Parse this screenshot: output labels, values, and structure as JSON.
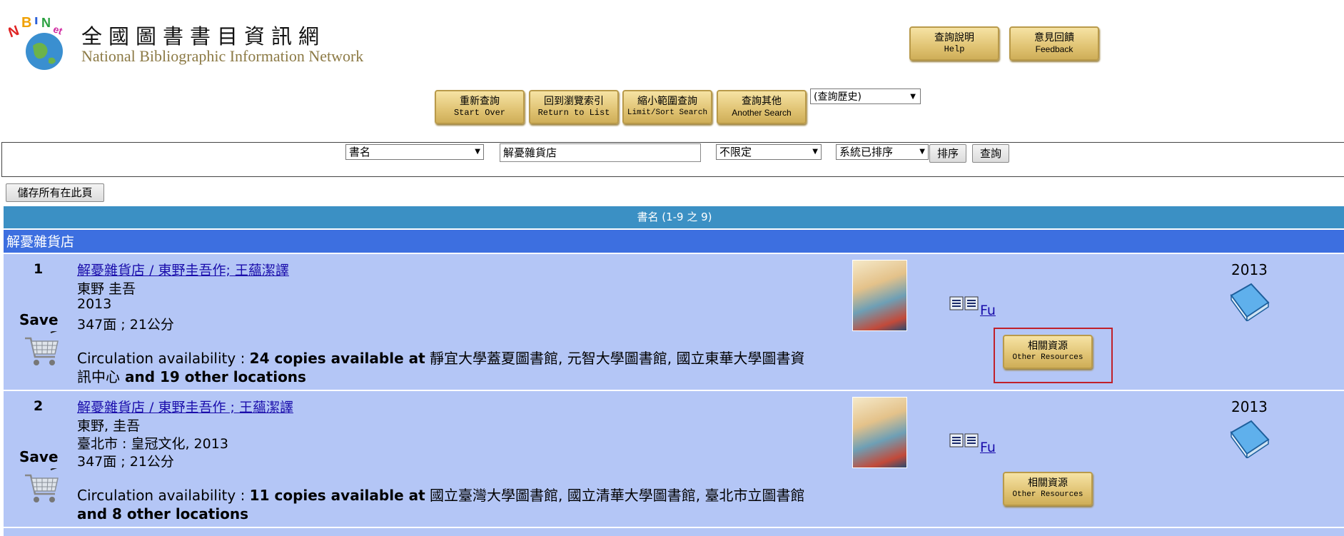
{
  "header": {
    "title_zh": "全國圖書書目資訊網",
    "title_en": "National Bibliographic Information Network",
    "logo_alt": "NBINet",
    "help": {
      "zh": "查詢說明",
      "en": "Help"
    },
    "feedback": {
      "zh": "意見回饋",
      "en": "Feedback"
    }
  },
  "toolbar": {
    "start_over": {
      "zh": "重新查詢",
      "en": "Start Over"
    },
    "return_list": {
      "zh": "回到瀏覽索引",
      "en": "Return to List"
    },
    "limit_sort": {
      "zh": "縮小範圍查詢",
      "en": "Limit/Sort Search"
    },
    "another": {
      "zh": "查詢其他",
      "en": "Another Search"
    },
    "history": "(查詢歷史)"
  },
  "search": {
    "field": "書名",
    "query": "解憂雜貨店",
    "limit": "不限定",
    "sort": "系統已排序",
    "sort_button": "排序",
    "search_button": "查詢"
  },
  "save_all_button": "儲存所有在此頁",
  "results_header": "書名 (1-9 之 9)",
  "group_heading": "解憂雜貨店",
  "records": [
    {
      "num": "1",
      "save": "Save",
      "title": "解憂雜貨店 / 東野圭吾作; 王蘊潔譯",
      "author": "東野 圭吾",
      "pub": "2013",
      "extent": "347面 ; 21公分",
      "circ_label": "Circulation availability : ",
      "circ_bold": "24 copies available at",
      "circ_libs": " 靜宜大學蓋夏圖書館, 元智大學圖書館, 國立東華大學圖書資訊中心",
      "circ_tail": " and 19 other locations",
      "fu": "Fu",
      "year": "2013",
      "other_res": {
        "zh": "相關資源",
        "en": "Other Resources"
      }
    },
    {
      "num": "2",
      "save": "Save",
      "title": "解憂雜貨店 / 東野圭吾作 ; 王蘊潔譯",
      "author": "東野, 圭吾",
      "pub": "臺北市 : 皇冠文化, 2013",
      "extent": "347面 ; 21公分",
      "circ_label": "Circulation availability : ",
      "circ_bold": "11 copies available at",
      "circ_libs": " 國立臺灣大學圖書館, 國立清華大學圖書館, 臺北市立圖書館",
      "circ_tail": " and 8 other locations",
      "fu": "Fu",
      "year": "2013",
      "other_res": {
        "zh": "相關資源",
        "en": "Other Resources"
      }
    }
  ],
  "colors": {
    "results_header_bg": "#3b90c4",
    "group_heading_bg": "#3d6fe0",
    "record_bg": "#b4c6f6",
    "highlight": "#c0202a"
  },
  "icons": [
    "globe-logo-icon",
    "shopping-cart-icon",
    "marc-view-icon",
    "book-icon",
    "dropdown-arrow-icon"
  ]
}
